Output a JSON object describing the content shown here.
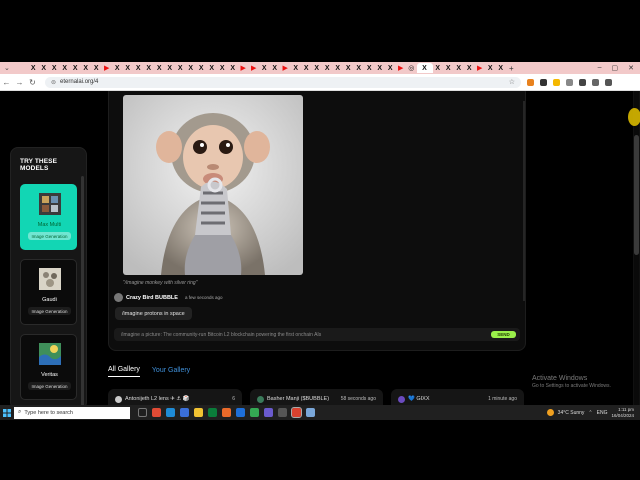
{
  "browser": {
    "url": "eternalai.org/4",
    "tab_glyphs": [
      "X",
      "X",
      "X",
      "X",
      "X",
      "X",
      "X",
      "▶",
      "X",
      "X",
      "X",
      "X",
      "X",
      "X",
      "X",
      "X",
      "X",
      "X",
      "X",
      "X",
      "▶",
      "▶",
      "X",
      "X",
      "▶",
      "X",
      "X",
      "X",
      "X",
      "X",
      "X",
      "X",
      "X",
      "X",
      "X",
      "▶",
      "◎",
      "X",
      "X",
      "X",
      "X",
      "X",
      "▶",
      "X",
      "X"
    ],
    "new_tab": "+",
    "window_controls": [
      "–",
      "▢",
      "✕"
    ]
  },
  "sidebar": {
    "title": "TRY THESE MODELS",
    "models": [
      {
        "name": "Max Multi",
        "tag": "Image Generation",
        "selected": true
      },
      {
        "name": "Gaudi",
        "tag": "Image Generation",
        "selected": false
      },
      {
        "name": "Veritas",
        "tag": "Image Generation",
        "selected": false
      }
    ]
  },
  "chat": {
    "caption": "\"/imagine monkey with silver ring\"",
    "poster_name": "Crazy Bird BUBBLE",
    "poster_time": "a few seconds ago",
    "chip": "/imagine protons in space",
    "prompt_placeholder": "/imagine a picture: The community-run Bitcoin L2 blockchain powering the first onchain AIs",
    "send_label": "SEND"
  },
  "gallery": {
    "tabs": [
      "All Gallery",
      "Your Gallery"
    ],
    "cards": [
      {
        "name": "Antonijeth L2 lens ✈ ⚓ 🎲",
        "time": "6"
      },
      {
        "name": "Basher Manji ($BUBBLE)",
        "time": "58 seconds ago"
      },
      {
        "name": "💙 GIXX",
        "time": "1 minute ago"
      }
    ]
  },
  "watermark": {
    "title": "Activate Windows",
    "subtitle": "Go to Settings to activate Windows."
  },
  "taskbar": {
    "search_placeholder": "Type here to search",
    "weather": "34°C  Sunny",
    "lang": "ENG",
    "time": "1:11 pm",
    "date": "16/04/2024"
  }
}
